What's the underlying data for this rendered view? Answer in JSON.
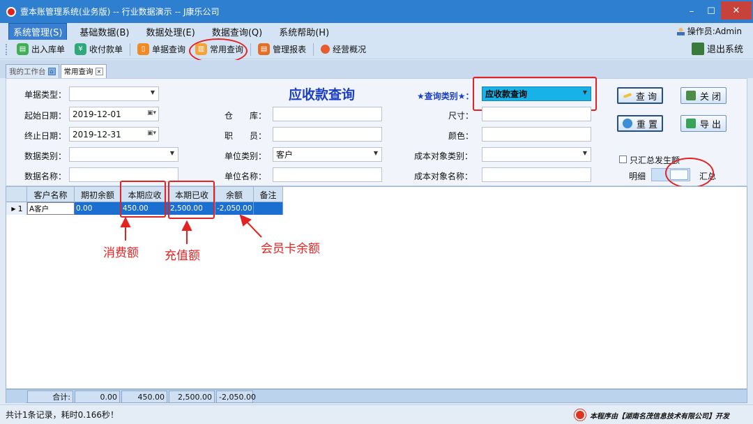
{
  "window": {
    "title": "壹本账管理系统(业务版) -- 行业数据演示 -- J康乐公司",
    "controls": [
      "–",
      "☐",
      "✕"
    ]
  },
  "menubar": {
    "items": [
      "系统管理(S)",
      "基础数据(B)",
      "数据处理(E)",
      "数据查询(Q)",
      "系统帮助(H)"
    ],
    "operator": "操作员:Admin"
  },
  "toolbar": {
    "items": [
      "出入库单",
      "收付款单",
      "单据查询",
      "常用查询",
      "管理报表",
      "经营概况"
    ],
    "exit": "退出系统"
  },
  "tabs": [
    "我的工作台",
    "常用查询"
  ],
  "form": {
    "heading": "应收款查询",
    "doc_type_label": "单据类型：",
    "doc_type_value": "",
    "start_date_label": "起始日期：",
    "start_date": "2019-12-01",
    "end_date_label": "终止日期：",
    "end_date": "2019-12-31",
    "data_type_label": "数据类别：",
    "data_type_value": "",
    "data_name_label": "数据名称：",
    "data_name_value": "",
    "warehouse_label": "仓　　库：",
    "warehouse_value": "",
    "staff_label": "职　　员：",
    "staff_value": "",
    "unit_type_label": "单位类别：",
    "unit_type_value": "客户",
    "unit_name_label": "单位名称：",
    "unit_name_value": "",
    "query_type_label": "★查询类别★：",
    "query_type_value": "应收款查询",
    "size_label": "尺寸：",
    "size_value": "",
    "color_label": "颜色：",
    "color_value": "",
    "cost_obj_type_label": "成本对象类别：",
    "cost_obj_type_value": "",
    "cost_obj_name_label": "成本对象名称：",
    "cost_obj_name_value": "",
    "only_summary_label": "只汇总发生额",
    "detail_label": "明细",
    "summary_label": "汇总"
  },
  "buttons": {
    "query": "查 询",
    "close": "关 闭",
    "reset": "重 置",
    "export": "导 出"
  },
  "grid": {
    "columns": [
      "客户名称",
      "期初余额",
      "本期应收",
      "本期已收",
      "余额",
      "备注"
    ],
    "rows": [
      {
        "index": "1",
        "name": "A客户",
        "opening": "0.00",
        "receivable": "450.00",
        "received": "2,500.00",
        "balance": "-2,050.00",
        "note": ""
      }
    ],
    "totals": {
      "label": "合计:",
      "opening": "0.00",
      "receivable": "450.00",
      "received": "2,500.00",
      "balance": "-2,050.00"
    }
  },
  "annotations": {
    "consume": "消费额",
    "recharge": "充值额",
    "card_balance": "会员卡余额"
  },
  "status": {
    "text": "共计1条记录，耗时0.166秒！",
    "vendor": "本程序由【湖南名茂信息技术有限公司】开发"
  },
  "colors": {
    "accent": "#2f7fd0",
    "highlight_red": "#e52222",
    "selection": "#1b6fd0"
  }
}
